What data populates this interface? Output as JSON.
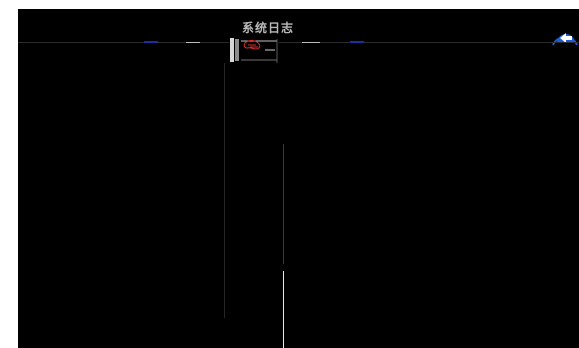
{
  "window": {
    "title": "系统日志"
  },
  "back_button": {
    "icon": "back-arrow-icon",
    "color": "#1e5bd6"
  },
  "colors": {
    "screen_background": "#000000",
    "title_text": "#b8b8b8",
    "accent_blue": "#1e5bd6"
  }
}
